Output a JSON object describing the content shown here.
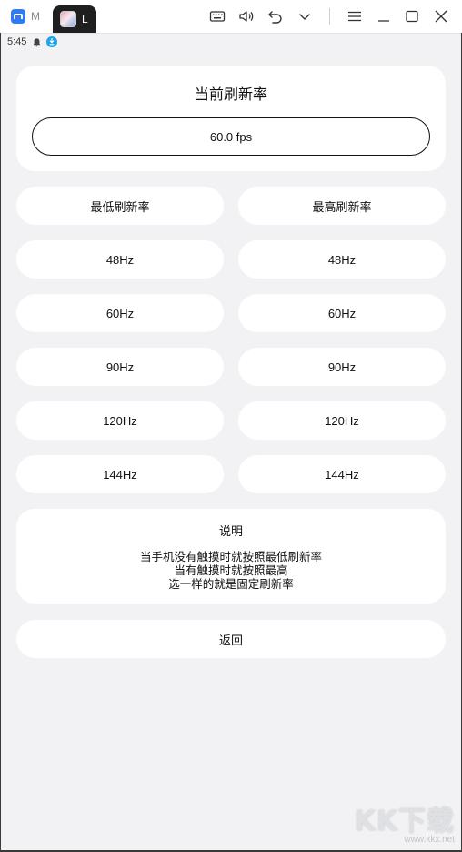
{
  "emulator": {
    "tabs": [
      {
        "label": "M"
      },
      {
        "label": "L"
      }
    ]
  },
  "status_bar": {
    "time": "5:45"
  },
  "current_rate": {
    "title": "当前刷新率",
    "value": "60.0 fps"
  },
  "min_column": {
    "header": "最低刷新率",
    "options": [
      "48Hz",
      "60Hz",
      "90Hz",
      "120Hz",
      "144Hz"
    ]
  },
  "max_column": {
    "header": "最高刷新率",
    "options": [
      "48Hz",
      "60Hz",
      "90Hz",
      "120Hz",
      "144Hz"
    ]
  },
  "description": {
    "title": "说明",
    "lines": [
      "当手机没有触摸时就按照最低刷新率",
      "当有触摸时就按照最高",
      "选一样的就是固定刷新率"
    ]
  },
  "back_button": {
    "label": "返回"
  },
  "watermark": {
    "main": "KK下载",
    "sub": "www.kkx.net"
  },
  "colors": {
    "background": "#f2f2f4",
    "card": "#ffffff",
    "text": "#111111"
  }
}
